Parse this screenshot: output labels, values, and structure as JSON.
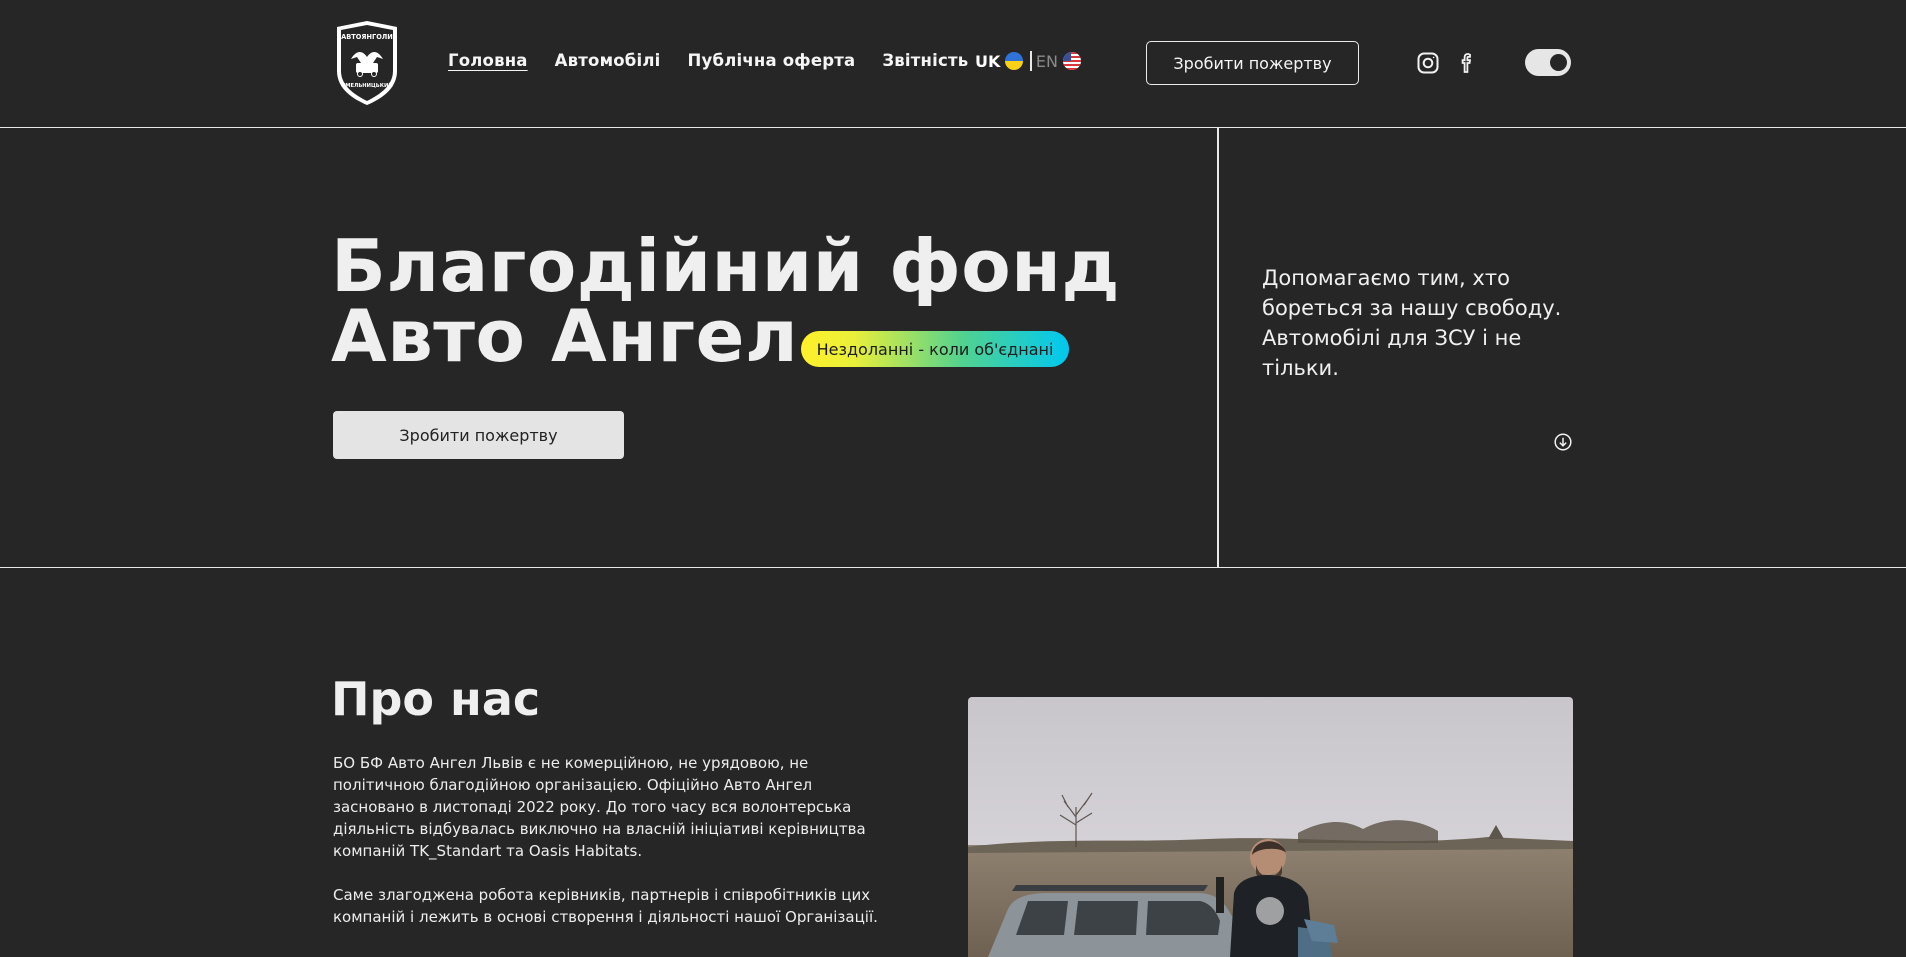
{
  "header": {
    "logo": {
      "top_text": "АВТОЯНГОЛИ",
      "bottom_text": "ХМЕЛЬНИЦЬКИЙ"
    },
    "nav": [
      {
        "label": "Головна",
        "active": true
      },
      {
        "label": "Автомобілі",
        "active": false
      },
      {
        "label": "Публічна оферта",
        "active": false
      },
      {
        "label": "Звітність",
        "active": false
      }
    ],
    "lang": {
      "uk": "UK",
      "en": "EN"
    },
    "donate_label": "Зробити пожертву",
    "icons": [
      "instagram-icon",
      "facebook-icon"
    ],
    "theme_toggle_on": true
  },
  "hero": {
    "title_line1": "Благодійний фонд",
    "title_line2": "Авто Ангел",
    "badge": "Нездоланні - коли об'єднані",
    "donate_label": "Зробити пожертву",
    "side_text": "Допомагаємо тим, хто бореться за нашу свободу. Автомобілі для ЗСУ і не тільки."
  },
  "about": {
    "title": "Про нас",
    "paragraph1": "БО БФ Авто Ангел Львів є не комерційною, не урядовою, не політичною благодійною організацією. Офіційно Авто Ангел засновано в листопаді 2022 року. До того часу вся волонтерська діяльність відбувалась виключно на власній ініціативі керівництва компаній TK_Standart та Oasis Habitats.",
    "paragraph2": "Саме злагоджена робота керівників, партнерів і співробітників цих компаній і лежить в основі створення і діяльності нашої Організації."
  },
  "colors": {
    "background": "#262626",
    "text": "#f2f2f2",
    "badge_gradient_start": "#fff12a",
    "badge_gradient_end": "#00c8f0"
  }
}
